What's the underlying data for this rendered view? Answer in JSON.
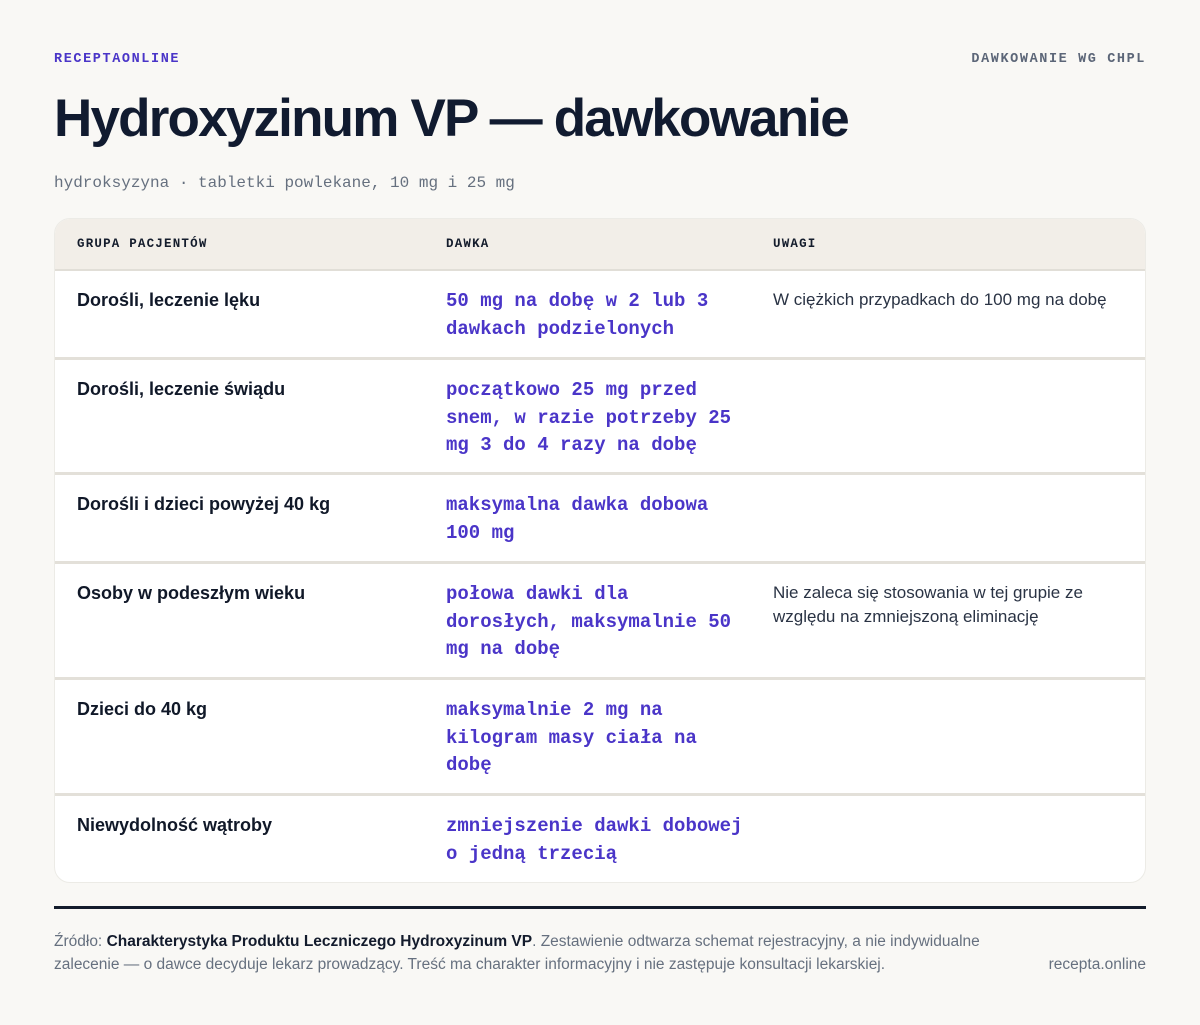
{
  "header": {
    "brand": "RECEPTAONLINE",
    "section": "DAWKOWANIE WG CHPL",
    "title": "Hydroxyzinum VP — dawkowanie",
    "subtitle": "hydroksyzyna · tabletki powlekane, 10 mg i 25 mg"
  },
  "table": {
    "columns": [
      "GRUPA PACJENTÓW",
      "DAWKA",
      "UWAGI"
    ],
    "rows": [
      {
        "group": "Dorośli, leczenie lęku",
        "dose": "50 mg na dobę w 2 lub 3 dawkach podzielonych",
        "note": "W ciężkich przypadkach do 100 mg na dobę"
      },
      {
        "group": "Dorośli, leczenie świądu",
        "dose": "początkowo 25 mg przed snem, w razie potrzeby 25 mg 3 do 4 razy na dobę",
        "note": ""
      },
      {
        "group": "Dorośli i dzieci powyżej 40 kg",
        "dose": "maksymalna dawka dobowa 100 mg",
        "note": ""
      },
      {
        "group": "Osoby w podeszłym wieku",
        "dose": "połowa dawki dla dorosłych, maksymalnie 50 mg na dobę",
        "note": "Nie zaleca się stosowania w tej grupie ze względu na zmniejszoną eliminację"
      },
      {
        "group": "Dzieci do 40 kg",
        "dose": "maksymalnie 2 mg na kilogram masy ciała na dobę",
        "note": ""
      },
      {
        "group": "Niewydolność wątroby",
        "dose": "zmniejszenie dawki dobowej o jedną trzecią",
        "note": ""
      }
    ]
  },
  "footer": {
    "source_prefix": "Źródło: ",
    "source_name": "Charakterystyka Produktu Leczniczego Hydroxyzinum VP",
    "source_suffix": ". Zestawienie odtwarza schemat rejestracyjny, a nie indywidualne zalecenie — o dawce decyduje lekarz prowadzący. Treść ma charakter informacyjny i nie zastępuje konsultacji lekarskiej.",
    "site": "recepta.online"
  }
}
